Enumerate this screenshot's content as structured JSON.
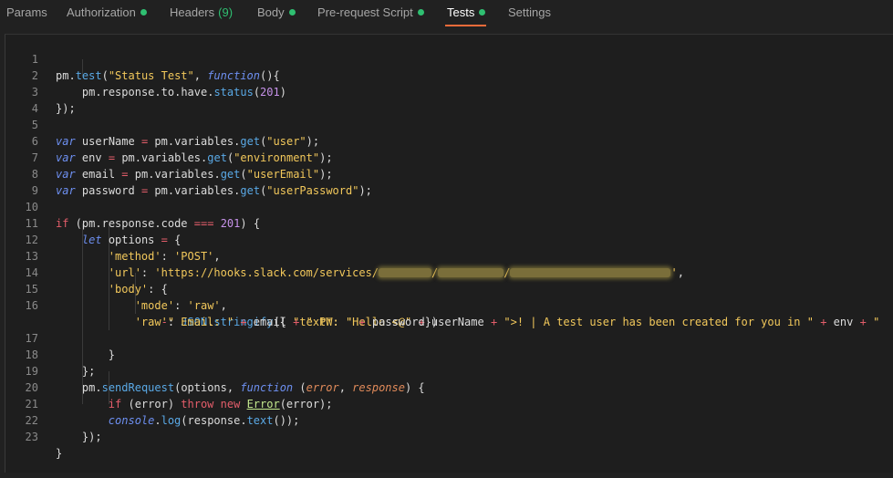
{
  "tabs": [
    {
      "label": "Params"
    },
    {
      "label": "Authorization"
    },
    {
      "label": "Headers"
    },
    {
      "label": "Body"
    },
    {
      "label": "Pre-request Script"
    },
    {
      "label": "Tests"
    },
    {
      "label": "Settings"
    }
  ],
  "headers_count": "(9)",
  "active_tab": "Tests",
  "colors": {
    "accent": "#f26b3a",
    "status_dot": "#2fbf71",
    "background": "#212121"
  },
  "editor": {
    "line_numbers": [
      "1",
      "2",
      "3",
      "4",
      "5",
      "6",
      "7",
      "8",
      "9",
      "10",
      "11",
      "12",
      "13",
      "14",
      "15",
      "16",
      "17",
      "18",
      "19",
      "20",
      "21",
      "22",
      "23"
    ],
    "t": {
      "pm": "pm",
      "test": "test",
      "status_test": "\"Status Test\"",
      "function": "function",
      "response": "response",
      "to": "to",
      "have": "have",
      "status": "status",
      "n201": "201",
      "var": "var",
      "userName": "userName",
      "variables": "variables",
      "get": "get",
      "s_user": "\"user\"",
      "env": "env",
      "s_environment": "\"environment\"",
      "email": "email",
      "s_userEmail": "\"userEmail\"",
      "password": "password",
      "s_userPassword": "\"userPassword\"",
      "if": "if",
      "code": "code",
      "let": "let",
      "options": "options",
      "s_method": "'method'",
      "s_post": "'POST'",
      "s_url": "'url'",
      "s_url_val": "'https://hooks.slack.com/services/",
      "s_body": "'body'",
      "s_mode": "'mode'",
      "s_raw_val": "'raw'",
      "s_raw": "'raw'",
      "json": "JSON",
      "stringify": "stringify",
      "s_text": "\"text\"",
      "s_hello": "\"Hello <@\"",
      "s_msg": "\">! | A test user has been created for you in \"",
      "s_quote": "\"",
      "s_email": "\" Email: \"",
      "s_pw": "\" PW: \"",
      "sendRequest": "sendRequest",
      "error": "error",
      "throw": "throw",
      "new": "new",
      "Error": "Error",
      "console": "console",
      "log": "log",
      "text": "text"
    }
  }
}
